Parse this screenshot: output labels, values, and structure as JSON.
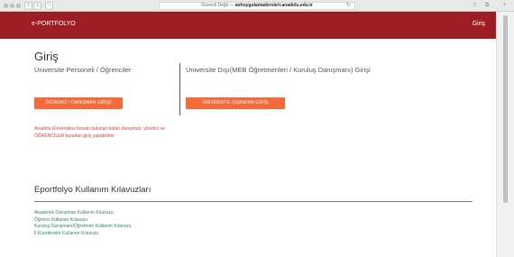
{
  "browser": {
    "address_prefix": "Güvenli Değil — ",
    "address_host": "aohuygulamadersleri.anadolu.edu.tr"
  },
  "topbar": {
    "brand": "e-PORTFOLYO",
    "login": "Giriş",
    "color": "#9e1c24"
  },
  "main": {
    "title": "Giriş",
    "left_heading": "Üniversite Personeli / Öğrenciler",
    "right_heading": "Üniversite Dışı(MEB Öğretmenleri / Kuruluş Danışmanı) Girişi",
    "student_button": "ÖĞRENCİ / DANIŞMAN GİRİŞİ",
    "outside_button": "ÜNİVERSİTE DIŞINDAN GİRİŞ",
    "note": "Anadolu Üniversitesi hesabı bulunan bütün danışman, yönetici ve ÖĞRENCİLER buradan giriş yapabilirler",
    "button_color": "#f46a3a"
  },
  "guides": {
    "title": "Eportfolyo Kullanım Kılavuzları",
    "items": [
      "Akademik Danışman Kullanım Kılavuzu",
      "Öğrenci Kullanım Kılavuzu",
      "Kuruluş Danışmanı/Öğretmen Kullanım Kılavuzu",
      "İl Koordinatör Kullanım Kılavuzu"
    ]
  }
}
